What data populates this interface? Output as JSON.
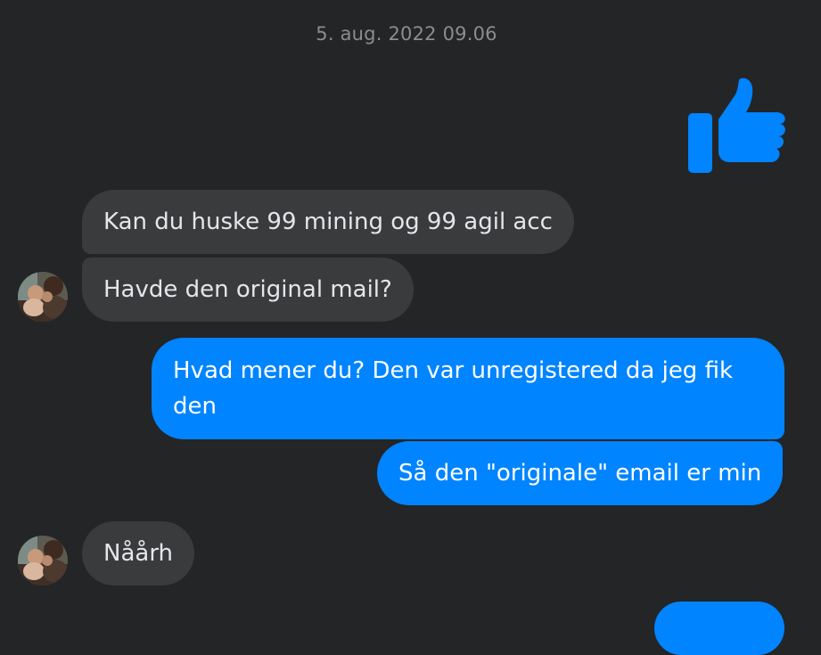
{
  "conversation": {
    "timestamp": "5. aug. 2022 09.06",
    "messages": [
      {
        "sender": "me",
        "type": "like-sticker",
        "icon": "thumbs-up-icon"
      },
      {
        "sender": "other",
        "text": "Kan du huske 99 mining og 99 agil acc"
      },
      {
        "sender": "other",
        "text": "Havde den original mail?"
      },
      {
        "sender": "me",
        "text": "Hvad mener du? Den var unregistered da jeg fik den"
      },
      {
        "sender": "me",
        "text": "Så den \"originale\" email er min"
      },
      {
        "sender": "other",
        "text": "Nåårh"
      },
      {
        "sender": "me",
        "text": ""
      }
    ]
  },
  "colors": {
    "background": "#242526",
    "incoming_bubble": "#3a3b3c",
    "outgoing_bubble": "#0084ff",
    "timestamp_text": "#8a8d91"
  }
}
